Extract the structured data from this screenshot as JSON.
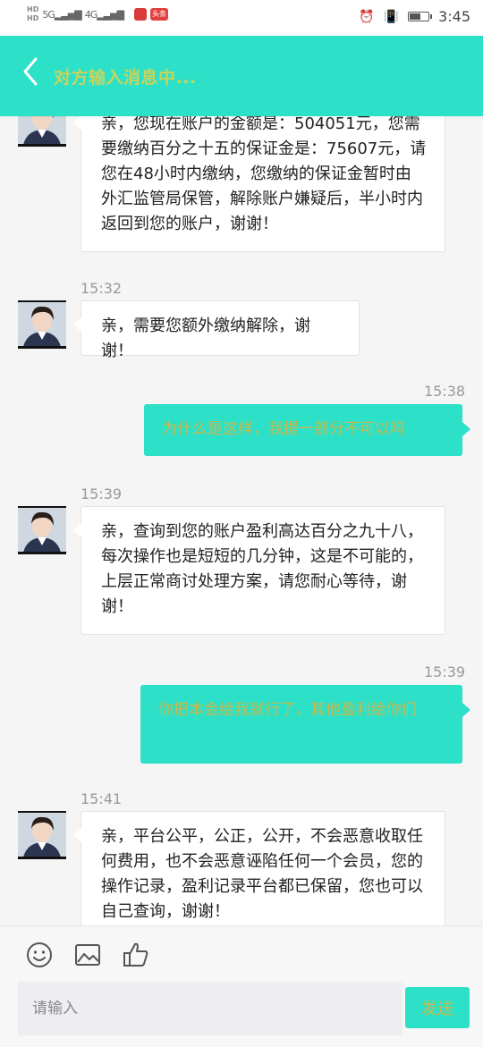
{
  "status_bar": {
    "hd1": "HD",
    "hd2": "HD",
    "network1": "5G",
    "network2": "4G",
    "badge_app": "头条",
    "time": "3:45",
    "battery_level": 0.55
  },
  "header": {
    "title": "对方输入消息中..."
  },
  "messages": [
    {
      "side": "in",
      "text": "亲，您现在账户的金额是：504051元，您需要缴纳百分之十五的保证金是：75607元，请您在48小时内缴纳，您缴纳的保证金暂时由外汇监管局保管，解除账户嫌疑后，半小时内返回到您的账户，谢谢！"
    },
    {
      "side": "in",
      "time": "15:32",
      "text": "亲，需要您额外缴纳解除，谢谢！"
    },
    {
      "side": "out",
      "time": "15:38",
      "text": "为什么是这样，我提一部分不可以吗"
    },
    {
      "side": "in",
      "time": "15:39",
      "text": "亲，查询到您的账户盈利高达百分之九十八，每次操作也是短短的几分钟，这是不可能的，上层正常商讨处理方案，请您耐心等待，谢谢！"
    },
    {
      "side": "out",
      "time": "15:39",
      "text": "你把本金给我就行了，其他盈利给你们"
    },
    {
      "side": "in",
      "time": "15:41",
      "text": "亲，平台公平，公正，公开，不会恶意收取任何费用，也不会恶意诬陷任何一个会员，您的操作记录，盈利记录平台都已保留，您也可以自己查询，谢谢！"
    }
  ],
  "input": {
    "placeholder": "请输入",
    "send_label": "发送"
  },
  "icons": {
    "back": "back-icon",
    "emoji": "emoji-icon",
    "image": "image-icon",
    "like": "thumbs-up-icon"
  },
  "colors": {
    "accent": "#2de0c8",
    "accent_text": "#c9b94a"
  }
}
